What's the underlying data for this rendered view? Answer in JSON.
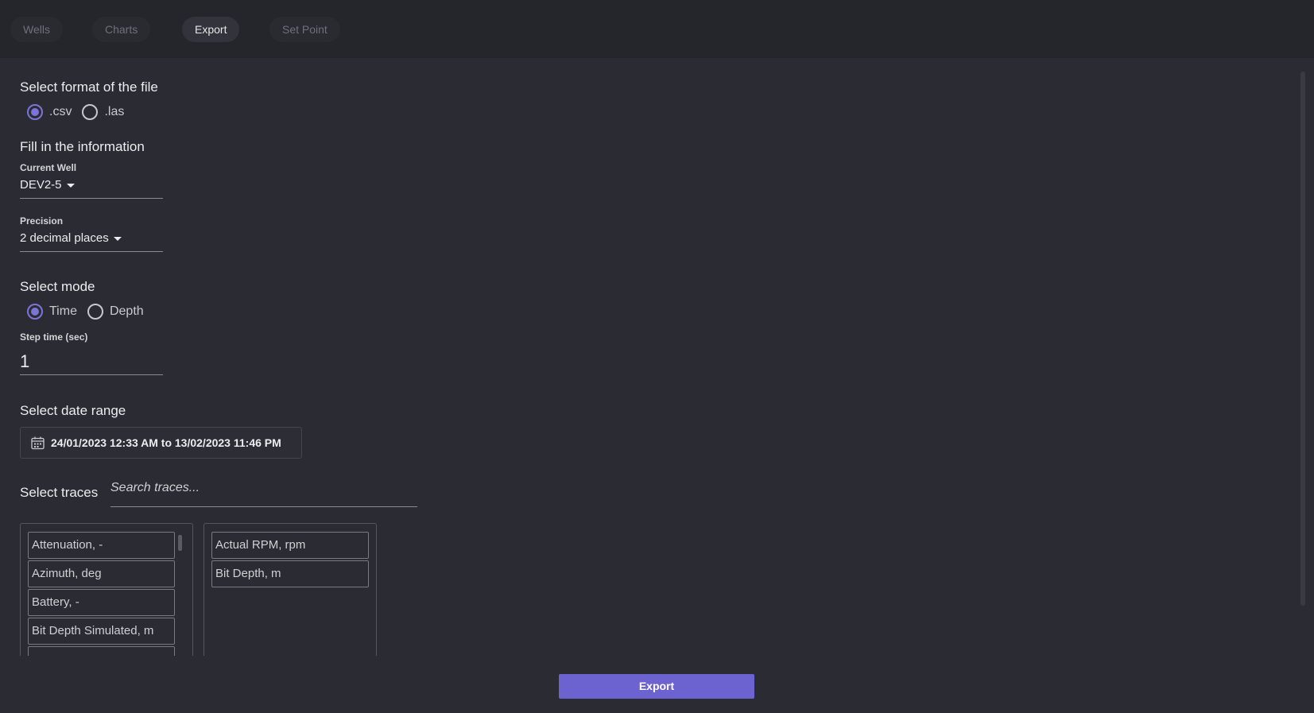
{
  "tabs": [
    {
      "label": "Wells"
    },
    {
      "label": "Charts"
    },
    {
      "label": "Export"
    },
    {
      "label": "Set Point"
    }
  ],
  "format": {
    "title": "Select format of the file",
    "options": [
      {
        "label": ".csv",
        "checked": true
      },
      {
        "label": ".las",
        "checked": false
      }
    ]
  },
  "info": {
    "title": "Fill in the information",
    "current_well_label": "Current Well",
    "current_well_value": "DEV2-5",
    "precision_label": "Precision",
    "precision_value": "2 decimal places"
  },
  "mode": {
    "title": "Select mode",
    "options": [
      {
        "label": "Time",
        "checked": true
      },
      {
        "label": "Depth",
        "checked": false
      }
    ],
    "step_label": "Step time (sec)",
    "step_value": "1"
  },
  "date_range": {
    "title": "Select date range",
    "value": "24/01/2023 12:33 AM to 13/02/2023 11:46 PM"
  },
  "traces": {
    "title": "Select traces",
    "search_placeholder": "Search traces...",
    "available": [
      "Attenuation, -",
      "Azimuth, deg",
      "Battery, -",
      "Bit Depth Simulated, m"
    ],
    "selected": [
      "Actual RPM, rpm",
      "Bit Depth, m"
    ]
  },
  "export_label": "Export",
  "colors": {
    "accent": "#6c63d1",
    "background": "#2b2c33",
    "topbar": "#25262c"
  }
}
